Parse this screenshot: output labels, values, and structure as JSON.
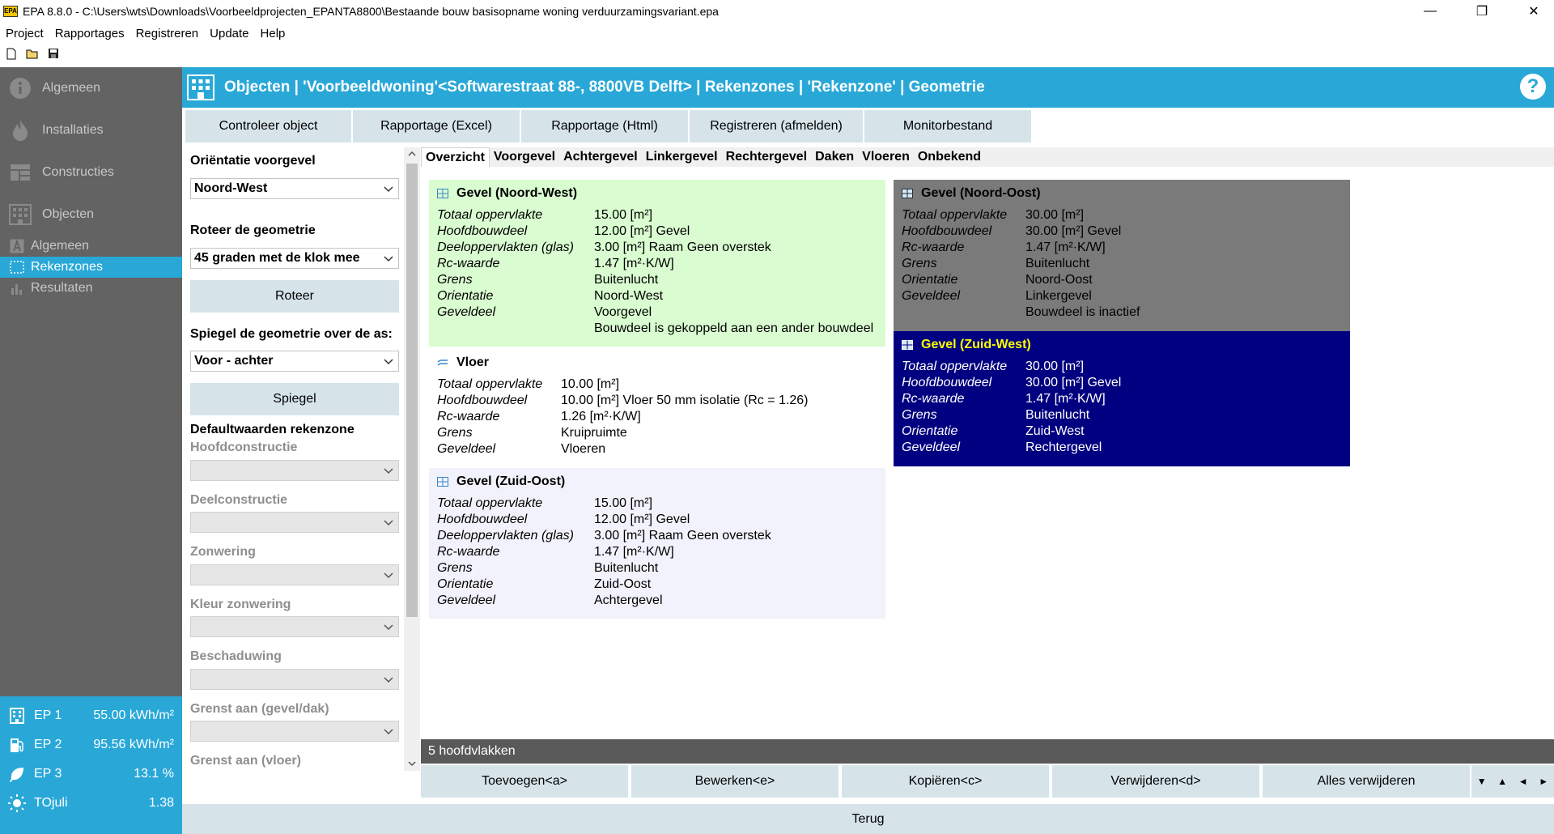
{
  "window": {
    "app_logo": "EPA",
    "title": "EPA 8.8.0 - C:\\Users\\wts\\Downloads\\Voorbeeldprojecten_EPANTA8800\\Bestaande bouw basisopname woning verduurzamingsvariant.epa",
    "minimize": "—",
    "maximize": "❐",
    "close": "✕"
  },
  "menu": [
    "Project",
    "Rapportages",
    "Registreren",
    "Update",
    "Help"
  ],
  "sidebar": {
    "nav": [
      {
        "label": "Algemeen",
        "icon": "info-icon"
      },
      {
        "label": "Installaties",
        "icon": "flame-icon"
      },
      {
        "label": "Constructies",
        "icon": "constructions-icon"
      },
      {
        "label": "Objecten",
        "icon": "building-icon"
      }
    ],
    "sub": [
      {
        "label": "Algemeen",
        "icon": "letter-a-icon"
      },
      {
        "label": "Rekenzones",
        "icon": "zones-icon"
      },
      {
        "label": "Resultaten",
        "icon": "bar-chart-icon"
      }
    ],
    "ep": [
      {
        "label": "EP 1",
        "value": "55.00 kWh/m²",
        "icon": "building-icon"
      },
      {
        "label": "EP 2",
        "value": "95.56 kWh/m²",
        "icon": "fuel-pump-icon"
      },
      {
        "label": "EP 3",
        "value": "13.1 %",
        "icon": "leaf-icon"
      },
      {
        "label": "TOjuli",
        "value": "1.38",
        "icon": "sun-icon"
      }
    ]
  },
  "header": {
    "breadcrumb": "Objecten | 'Voorbeeldwoning'<Softwarestraat 88-, 8800VB Delft> | Rekenzones | 'Rekenzone' | Geometrie",
    "help": "?"
  },
  "actions": [
    "Controleer object",
    "Rapportage (Excel)",
    "Rapportage (Html)",
    "Registreren (afmelden)",
    "Monitorbestand"
  ],
  "settings": {
    "orientatie_label": "Oriëntatie voorgevel",
    "orientatie_value": "Noord-West",
    "roteer_label": "Roteer de geometrie",
    "roteer_value": "45 graden met de klok mee",
    "roteer_button": "Roteer",
    "spiegel_label": "Spiegel de geometrie over de as:",
    "spiegel_value": "Voor - achter",
    "spiegel_button": "Spiegel",
    "defaults_label": "Defaultwaarden rekenzone",
    "hoofdconstructie": "Hoofdconstructie",
    "deelconstructie": "Deelconstructie",
    "zonwering": "Zonwering",
    "kleur_zonwering": "Kleur zonwering",
    "beschaduwing": "Beschaduwing",
    "grenst_gevel": "Grenst aan (gevel/dak)",
    "grenst_vloer": "Grenst aan (vloer)"
  },
  "tabs": [
    "Overzicht",
    "Voorgevel",
    "Achtergevel",
    "Linkergevel",
    "Rechtergevel",
    "Daken",
    "Vloeren",
    "Onbekend"
  ],
  "cards": [
    {
      "title": "Gevel (Noord-West)",
      "rows": [
        [
          "Totaal oppervlakte",
          "15.00 [m²]"
        ],
        [
          "Hoofdbouwdeel",
          "12.00 [m²] Gevel"
        ],
        [
          "Deeloppervlakten (glas)",
          "3.00 [m²] Raam Geen overstek"
        ],
        [
          "Rc-waarde",
          "1.47 [m²·K/W]"
        ],
        [
          "Grens",
          "Buitenlucht"
        ],
        [
          "Orientatie",
          "Noord-West"
        ],
        [
          "Geveldeel",
          "Voorgevel"
        ],
        [
          "",
          "Bouwdeel is gekoppeld aan een ander bouwdeel"
        ]
      ]
    },
    {
      "title": "Vloer",
      "rows": [
        [
          "Totaal oppervlakte",
          "10.00 [m²]"
        ],
        [
          "Hoofdbouwdeel",
          "10.00 [m²] Vloer 50 mm isolatie (Rc = 1.26)"
        ],
        [
          "Rc-waarde",
          "1.26 [m²·K/W]"
        ],
        [
          "Grens",
          "Kruipruimte"
        ],
        [
          "Geveldeel",
          "Vloeren"
        ]
      ]
    },
    {
      "title": "Gevel (Zuid-Oost)",
      "rows": [
        [
          "Totaal oppervlakte",
          "15.00 [m²]"
        ],
        [
          "Hoofdbouwdeel",
          "12.00 [m²] Gevel"
        ],
        [
          "Deeloppervlakten (glas)",
          "3.00 [m²] Raam Geen overstek"
        ],
        [
          "Rc-waarde",
          "1.47 [m²·K/W]"
        ],
        [
          "Grens",
          "Buitenlucht"
        ],
        [
          "Orientatie",
          "Zuid-Oost"
        ],
        [
          "Geveldeel",
          "Achtergevel"
        ]
      ]
    },
    {
      "title": "Gevel (Noord-Oost)",
      "rows": [
        [
          "Totaal oppervlakte",
          "30.00 [m²]"
        ],
        [
          "Hoofdbouwdeel",
          "30.00 [m²] Gevel"
        ],
        [
          "Rc-waarde",
          "1.47 [m²·K/W]"
        ],
        [
          "Grens",
          "Buitenlucht"
        ],
        [
          "Orientatie",
          "Noord-Oost"
        ],
        [
          "Geveldeel",
          "Linkergevel"
        ],
        [
          "",
          "Bouwdeel is inactief"
        ]
      ]
    },
    {
      "title": "Gevel (Zuid-West)",
      "rows": [
        [
          "Totaal oppervlakte",
          "30.00 [m²]"
        ],
        [
          "Hoofdbouwdeel",
          "30.00 [m²] Gevel"
        ],
        [
          "Rc-waarde",
          "1.47 [m²·K/W]"
        ],
        [
          "Grens",
          "Buitenlucht"
        ],
        [
          "Orientatie",
          "Zuid-West"
        ],
        [
          "Geveldeel",
          "Rechtergevel"
        ]
      ]
    }
  ],
  "count": "5 hoofdvlakken",
  "bottom_buttons": [
    "Toevoegen<a>",
    "Bewerken<e>",
    "Kopiëren<c>",
    "Verwijderen<d>",
    "Alles verwijderen"
  ],
  "nav_arrows": [
    "▼",
    "▲",
    "◄",
    "►"
  ],
  "back": "Terug",
  "colors": {
    "accent": "#29a8d8",
    "sidebar": "#636363",
    "button": "#d6e4ea",
    "card_selected": "#d9fcd0",
    "card_inactive": "#7a7a7a",
    "card_highlight": "#000080",
    "card_highlight_title": "#ffff00"
  }
}
